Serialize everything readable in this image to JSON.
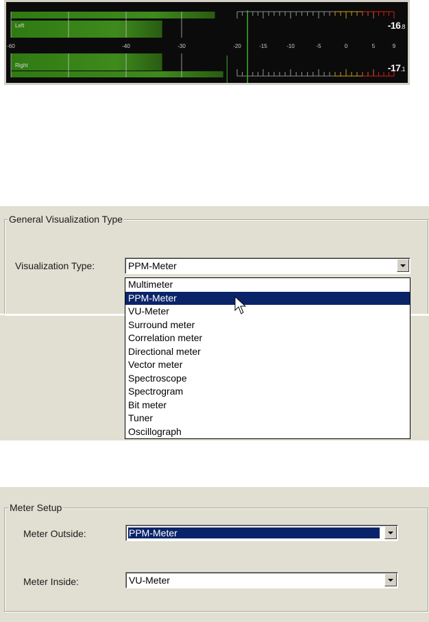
{
  "meter": {
    "channels": [
      {
        "name": "Left",
        "peak_db": -24,
        "rms_db": -33.5,
        "readout_int": "-16",
        "readout_dec": "8"
      },
      {
        "name": "Right",
        "peak_db": -33.5,
        "rms_db": -22.5,
        "readout_int": "-17",
        "readout_dec": "1"
      }
    ],
    "scale_labels": [
      "-60",
      "-40",
      "-30",
      "-20",
      "-15",
      "-10",
      "-5",
      "0",
      "5",
      "9"
    ],
    "marker_db": -18,
    "colors": {
      "green": "#3e8a1c",
      "yellow": "#c9a21a",
      "orange": "#d8661c",
      "red": "#d41e1e"
    }
  },
  "general": {
    "group_title": "General Visualization Type",
    "label": "Visualization Type:",
    "selected": "PPM-Meter",
    "options": [
      "Multimeter",
      "PPM-Meter",
      "VU-Meter",
      "Surround meter",
      "Correlation meter",
      "Directional meter",
      "Vector meter",
      "Spectroscope",
      "Spectrogram",
      "Bit meter",
      "Tuner",
      "Oscillograph"
    ],
    "highlighted_index": 1
  },
  "meter_setup": {
    "group_title": "Meter Setup",
    "outside_label": "Meter Outside:",
    "outside_value": "PPM-Meter",
    "inside_label": "Meter Inside:",
    "inside_value": "VU-Meter"
  },
  "icons": {
    "dropdown": "chevron-down-icon",
    "cursor": "mouse-pointer-icon"
  }
}
